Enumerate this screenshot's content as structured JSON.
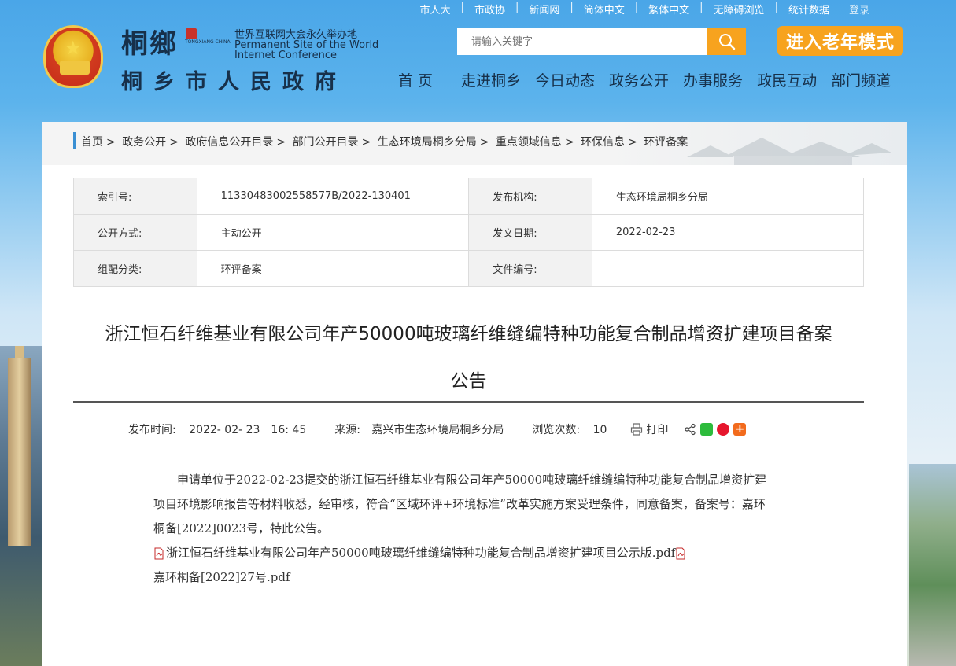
{
  "top_links": [
    "市人大",
    "市政协",
    "新闻网",
    "简体中文",
    "繁体中文",
    "无障碍浏览",
    "统计数据"
  ],
  "login_label": "登录",
  "logo": {
    "calligraphy": "桐鄉",
    "tongxiang_en": "TONGXIANG CHINA",
    "wic_cn": "世界互联网大会永久举办地",
    "wic_en_line1": "Permanent Site of the World",
    "wic_en_line2": "Internet Conference",
    "site_title": "桐乡市人民政府"
  },
  "search": {
    "placeholder": "请输入关键字"
  },
  "elder_mode_label": "进入老年模式",
  "nav": [
    "首页",
    "走进桐乡",
    "今日动态",
    "政务公开",
    "办事服务",
    "政民互动",
    "部门频道"
  ],
  "breadcrumb": [
    "首页",
    "政务公开",
    "政府信息公开目录",
    "部门公开目录",
    "生态环境局桐乡分局",
    "重点领域信息",
    "环保信息",
    "环评备案"
  ],
  "meta": {
    "index_label": "索引号:",
    "index_value": "11330483002558577B/2022-130401",
    "org_label": "发布机构:",
    "org_value": "生态环境局桐乡分局",
    "mode_label": "公开方式:",
    "mode_value": "主动公开",
    "date_label": "发文日期:",
    "date_value": "2022-02-23",
    "category_label": "组配分类:",
    "category_value": "环评备案",
    "docno_label": "文件编号:",
    "docno_value": ""
  },
  "article": {
    "title_line1": "浙江恒石纤维基业有限公司年产50000吨玻璃纤维缝编特种功能复合制品增资扩建项目备案",
    "title_line2": "公告",
    "publish_label": "发布时间:",
    "publish_value": "2022- 02- 23　16: 45",
    "source_label": "来源:",
    "source_value": "嘉兴市生态环境局桐乡分局",
    "views_label": "浏览次数:",
    "views_value": "10",
    "print_label": "打印",
    "body": "申请单位于2022-02-23提交的浙江恒石纤维基业有限公司年产50000吨玻璃纤维缝编特种功能复合制品增资扩建项目环境影响报告等材料收悉，经审核，符合“区域环评+环境标准”改革实施方案受理条件，同意备案，备案号：嘉环桐备[2022]0023号，特此公告。",
    "attachment1": "浙江恒石纤维基业有限公司年产50000吨玻璃纤维缝编特种功能复合制品增资扩建项目公示版.pdf",
    "attachment2": "嘉环桐备[2022]27号.pdf"
  },
  "colors": {
    "accent_orange": "#f7a31e",
    "header_blue": "#4aa6e8",
    "title_navy": "#17304a"
  },
  "icons": [
    "search-icon",
    "print-icon",
    "share-icon",
    "wechat-icon",
    "weibo-icon",
    "plus-share-icon",
    "pdf-icon"
  ]
}
